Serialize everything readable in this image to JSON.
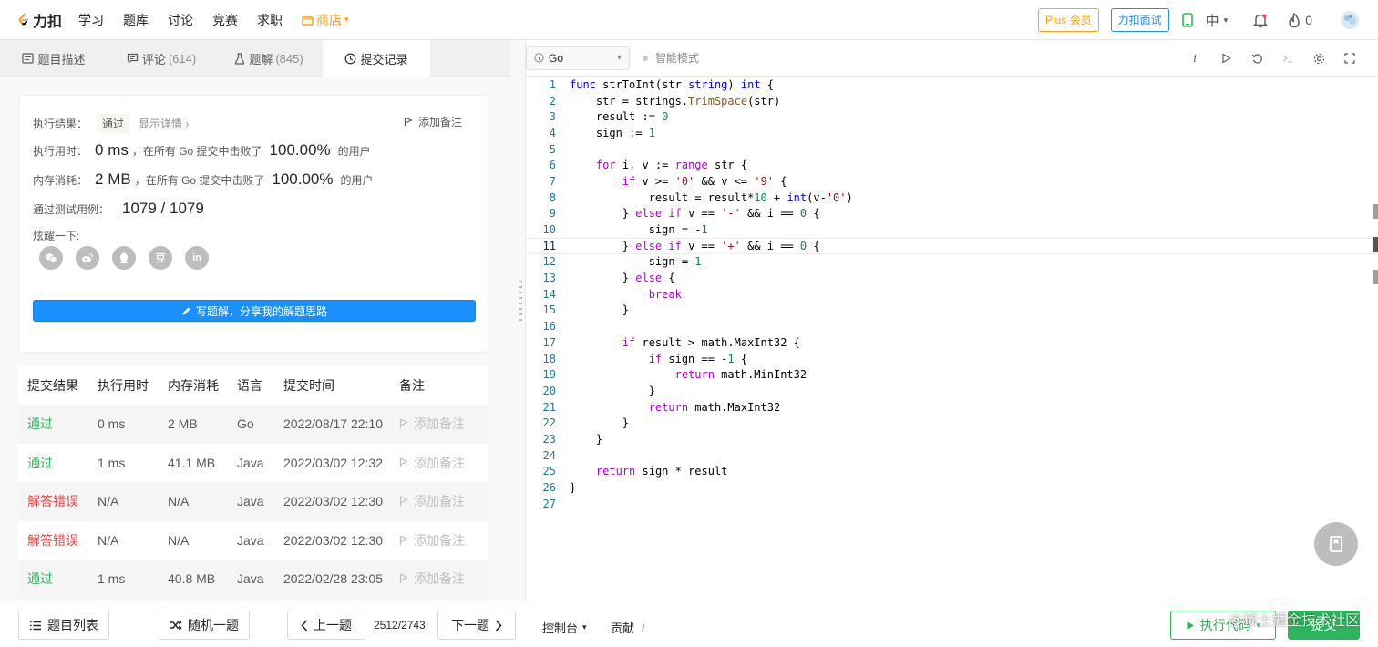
{
  "header": {
    "logo_text": "力扣",
    "nav": [
      "学习",
      "题库",
      "讨论",
      "竞赛",
      "求职"
    ],
    "shop_label": "商店",
    "plus_label": "Plus 会员",
    "interview_label": "力扣面试",
    "language": "中",
    "points": "0",
    "brand_color": "#ffa116"
  },
  "tabs": [
    {
      "label": "题目描述",
      "count": "",
      "icon": "description-icon"
    },
    {
      "label": "评论",
      "count": "(614)",
      "icon": "comment-icon"
    },
    {
      "label": "题解",
      "count": "(845)",
      "icon": "flask-icon"
    },
    {
      "label": "提交记录",
      "count": "",
      "icon": "clock-icon"
    }
  ],
  "result": {
    "result_label": "执行结果：",
    "status": "通过",
    "detail_link": "显示详情 ›",
    "add_note": "添加备注",
    "runtime_label": "执行用时：",
    "runtime_value": "0 ms",
    "runtime_text": "，在所有 Go 提交中击败了",
    "runtime_pct": "100.00%",
    "users_suffix": "的用户",
    "memory_label": "内存消耗：",
    "memory_value": "2 MB",
    "memory_text": "，在所有 Go 提交中击败了",
    "memory_pct": "100.00%",
    "tests_label": "通过测试用例：",
    "tests_value": "1079 / 1079",
    "share_label": "炫耀一下:",
    "share_icons": [
      "wechat-icon",
      "weibo-icon",
      "qq-icon",
      "douban-icon",
      "linkedin-icon"
    ],
    "write_solution": "写题解，分享我的解题思路"
  },
  "submissions": {
    "headers": [
      "提交结果",
      "执行用时",
      "内存消耗",
      "语言",
      "提交时间",
      "备注"
    ],
    "rows": [
      {
        "status": "通过",
        "ok": true,
        "runtime": "0 ms",
        "memory": "2 MB",
        "lang": "Go",
        "time": "2022/08/17 22:10",
        "note": "添加备注"
      },
      {
        "status": "通过",
        "ok": true,
        "runtime": "1 ms",
        "memory": "41.1 MB",
        "lang": "Java",
        "time": "2022/03/02 12:32",
        "note": "添加备注"
      },
      {
        "status": "解答错误",
        "ok": false,
        "runtime": "N/A",
        "memory": "N/A",
        "lang": "Java",
        "time": "2022/03/02 12:30",
        "note": "添加备注"
      },
      {
        "status": "解答错误",
        "ok": false,
        "runtime": "N/A",
        "memory": "N/A",
        "lang": "Java",
        "time": "2022/03/02 12:30",
        "note": "添加备注"
      },
      {
        "status": "通过",
        "ok": true,
        "runtime": "1 ms",
        "memory": "40.8 MB",
        "lang": "Java",
        "time": "2022/02/28 23:05",
        "note": "添加备注"
      }
    ]
  },
  "editor": {
    "language": "Go",
    "smart_mode": "智能模式",
    "current_line": 11,
    "lines": [
      "func strToInt(str string) int {",
      "    str = strings.TrimSpace(str)",
      "    result := 0",
      "    sign := 1",
      "",
      "    for i, v := range str {",
      "        if v >= '0' && v <= '9' {",
      "            result = result*10 + int(v-'0')",
      "        } else if v == '-' && i == 0 {",
      "            sign = -1",
      "        } else if v == '+' && i == 0 {",
      "            sign = 1",
      "        } else {",
      "            break",
      "        }",
      "",
      "        if result > math.MaxInt32 {",
      "            if sign == -1 {",
      "                return math.MinInt32",
      "            }",
      "            return math.MaxInt32",
      "        }",
      "    }",
      "",
      "    return sign * result",
      "}",
      ""
    ]
  },
  "bottom": {
    "problem_list": "题目列表",
    "random": "随机一题",
    "prev": "上一题",
    "counter": "2512/2743",
    "next": "下一题",
    "console": "控制台",
    "contribute": "贡献",
    "run": "执行代码",
    "submit": "提交",
    "watermark": "@稀土掘金技术社区"
  }
}
